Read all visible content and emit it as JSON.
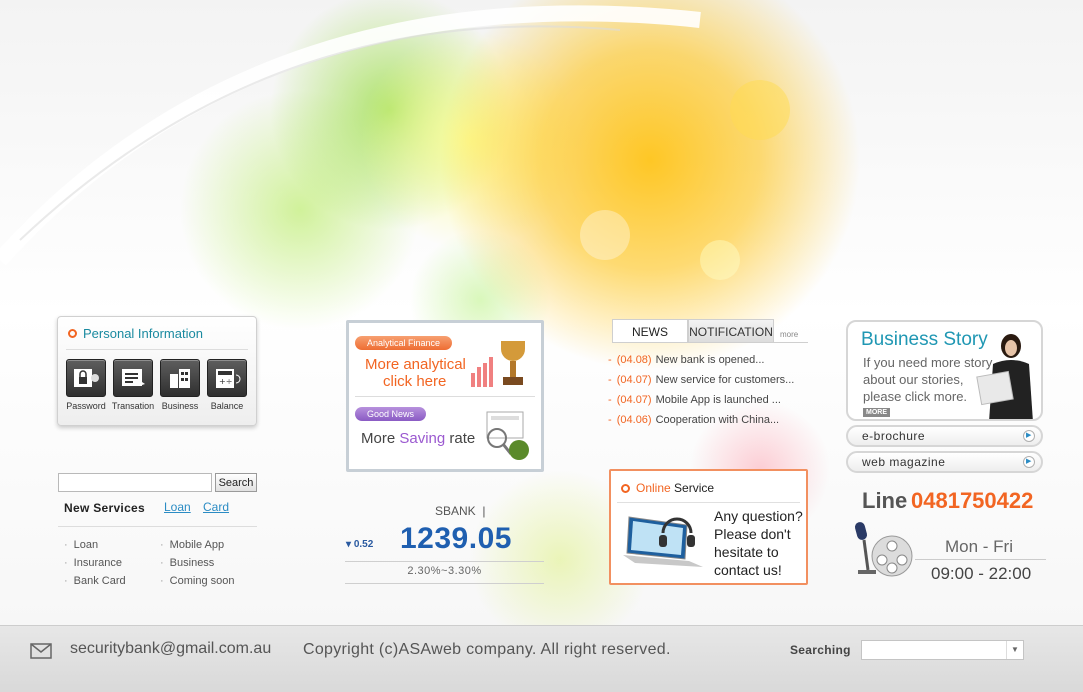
{
  "colors": {
    "accent": "#f26522",
    "teal": "#1a8aa0",
    "blue": "#1f5fb0"
  },
  "personal": {
    "title": "Personal Information",
    "items": [
      {
        "label": "Password",
        "icon": "lock-icon"
      },
      {
        "label": "Transation",
        "icon": "transaction-icon"
      },
      {
        "label": "Business",
        "icon": "building-icon"
      },
      {
        "label": "Balance",
        "icon": "calculator-icon"
      }
    ]
  },
  "search": {
    "button": "Search",
    "placeholder": ""
  },
  "services": {
    "title": "New Services",
    "tabs": [
      "Loan",
      "Card"
    ],
    "left": [
      "Loan",
      "Insurance",
      "Bank Card"
    ],
    "right": [
      "Mobile App",
      "Business",
      "Coming soon"
    ]
  },
  "promo": {
    "analytical": {
      "badge": "Analytical Finance",
      "line1": "More analytical",
      "line2": "click here"
    },
    "saving": {
      "badge": "Good News",
      "prefix": "More ",
      "highlight": "Saving",
      "suffix": " rate"
    }
  },
  "stock": {
    "name": "SBANK",
    "separator": "|",
    "change": "0.52",
    "price": "1239.05",
    "rate": "2.30%~3.30%"
  },
  "news": {
    "tabs": [
      "NEWS",
      "NOTIFICATION"
    ],
    "more": "more",
    "items": [
      {
        "date": "(04.08)",
        "text": "New bank is  opened..."
      },
      {
        "date": "(04.07)",
        "text": "New service for customers..."
      },
      {
        "date": "(04.07)",
        "text": "Mobile App is launched ..."
      },
      {
        "date": "(04.06)",
        "text": "Cooperation with China..."
      }
    ]
  },
  "online": {
    "title_a": "Online",
    "title_b": " Service",
    "lines": [
      "Any question?",
      "Please don't",
      "hesitate to",
      "contact us!"
    ]
  },
  "story": {
    "title": "Business Story",
    "lines": [
      "If you need more story",
      "about our stories,",
      "please click more."
    ],
    "more": "MORE"
  },
  "side_buttons": [
    "e-brochure",
    "web magazine"
  ],
  "contact": {
    "line_label": "Line",
    "phone": "0481750422",
    "days": "Mon - Fri",
    "hours": "09:00 - 22:00"
  },
  "footer": {
    "email": "securitybank@gmail.com.au",
    "copyright": "Copyright (c)ASAweb company. All right reserved.",
    "searching": "Searching"
  }
}
